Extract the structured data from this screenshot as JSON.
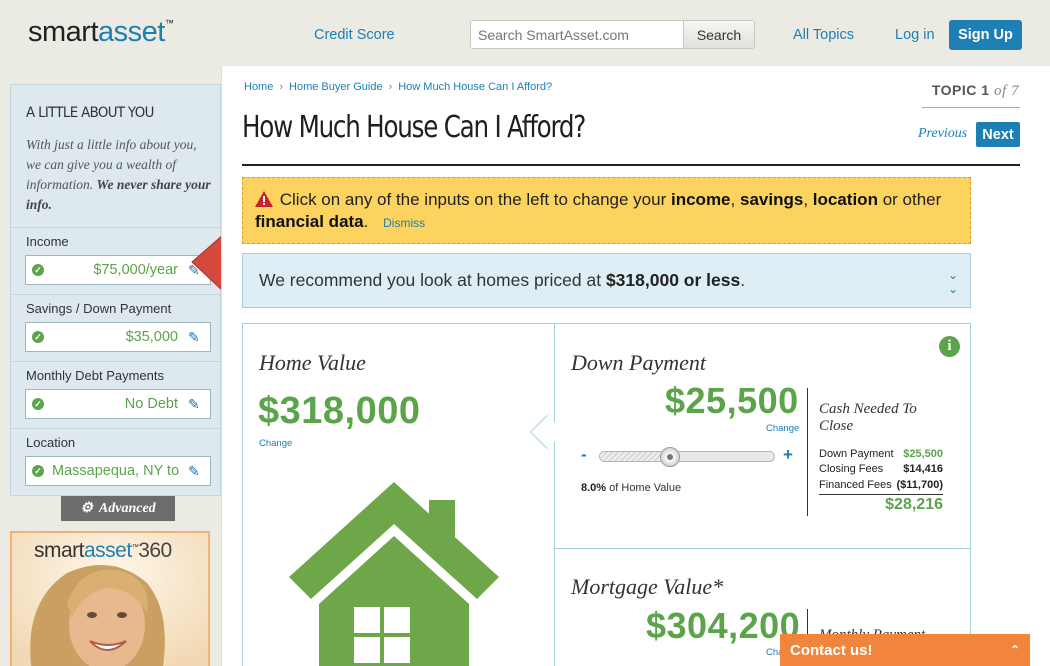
{
  "header": {
    "logo_smart": "smart",
    "logo_asset": "asset",
    "logo_tm": "™",
    "nav_credit_score": "Credit Score",
    "search_placeholder": "Search SmartAsset.com",
    "search_button": "Search",
    "nav_all_topics": "All Topics",
    "nav_login": "Log in",
    "signup_button": "Sign Up"
  },
  "sidebar": {
    "heading": "A LITTLE ABOUT YOU",
    "description_plain": "With just a little info about you, we can give you a wealth of information.",
    "description_bold": "We never share your info.",
    "fields": [
      {
        "label": "Income",
        "value": "$75,000/year"
      },
      {
        "label": "Savings / Down Payment",
        "value": "$35,000"
      },
      {
        "label": "Monthly Debt Payments",
        "value": "No Debt"
      },
      {
        "label": "Location",
        "value": "Massapequa, NY to"
      }
    ],
    "advanced_button": "Advanced",
    "promo": {
      "smart": "smart",
      "asset": "asset",
      "tm": "™",
      "num": "360"
    }
  },
  "main": {
    "breadcrumb": [
      "Home",
      "Home Buyer Guide",
      "How Much House Can I Afford?"
    ],
    "title": "How Much House Can I Afford?",
    "topic_label": "TOPIC",
    "topic_current": "1",
    "topic_of": "of",
    "topic_total": "7",
    "previous": "Previous",
    "next": "Next",
    "alert": {
      "t1": "Click on any of the inputs on the left to change your",
      "b1": "income",
      "t2": ",",
      "b2": "savings",
      "t3": ",",
      "b3": "location",
      "t4": "or other",
      "b4": "financial data",
      "t5": ".",
      "dismiss": "Dismiss"
    },
    "recommend": {
      "text": "We recommend you look at homes priced at",
      "amount": "$318,000 or less",
      "suffix": "."
    },
    "home_value": {
      "title": "Home Value",
      "amount": "$318,000",
      "change": "Change"
    },
    "down_payment": {
      "title": "Down Payment",
      "amount": "$25,500",
      "change": "Change",
      "minus": "-",
      "plus": "+",
      "percent": 0.08,
      "percent_text": "8.0%",
      "percent_label": "of Home Value",
      "cash_title": "Cash Needed To Close",
      "rows": [
        {
          "label": "Down Payment",
          "value": "$25,500"
        },
        {
          "label": "Closing Fees",
          "value": "$14,416"
        },
        {
          "label": "Financed Fees",
          "value": "($11,700)"
        }
      ],
      "total": "$28,216"
    },
    "mortgage_value": {
      "title": "Mortgage Value*",
      "amount": "$304,200",
      "change": "Cha",
      "side_title": "Monthly Payment"
    }
  },
  "contact": {
    "label": "Contact us!"
  },
  "colors": {
    "brand_blue": "#1d7fb3",
    "green": "#5ba44b",
    "alert_yellow": "#fbd35e",
    "contact_orange": "#f0853b"
  }
}
